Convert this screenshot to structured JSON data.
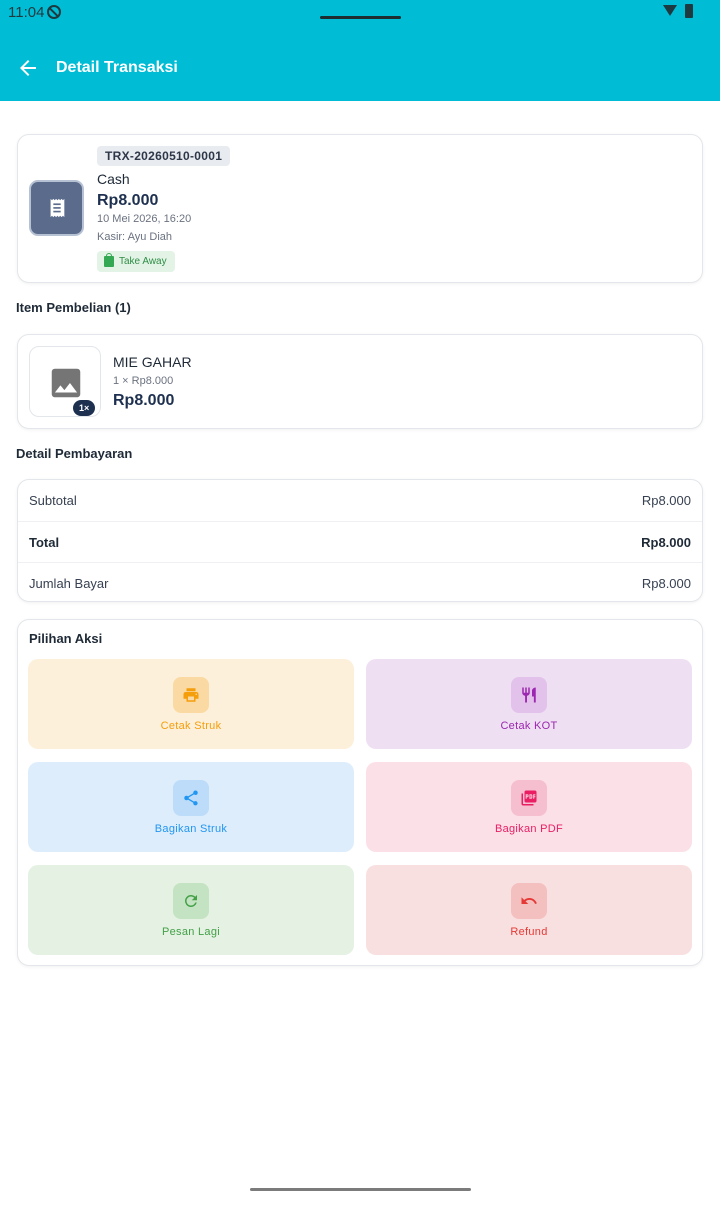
{
  "status_bar": {
    "time": "11:04"
  },
  "app_bar": {
    "title": "Detail Transaksi"
  },
  "transaction": {
    "id": "TRX-20260510-0001",
    "method": "Cash",
    "amount": "Rp8.000",
    "datetime": "10 Mei 2026, 16:20",
    "cashier": "Kasir: Ayu Diah",
    "order_type": "Take Away"
  },
  "items_section": {
    "title": "Item Pembelian (1)",
    "items": [
      {
        "name": "MIE GAHAR",
        "unit_line": "1 × Rp8.000",
        "total": "Rp8.000",
        "qty_badge": "1×"
      }
    ]
  },
  "payment_section": {
    "title": "Detail Pembayaran",
    "rows": [
      {
        "label": "Subtotal",
        "value": "Rp8.000"
      },
      {
        "label": "Total",
        "value": "Rp8.000"
      },
      {
        "label": "Jumlah Bayar",
        "value": "Rp8.000"
      }
    ]
  },
  "actions_section": {
    "title": "Pilihan Aksi",
    "actions": [
      {
        "label": "Cetak Struk",
        "icon": "printer-icon",
        "bg": "#fdf0da",
        "icon_bg": "#fbd9a3",
        "color": "#f59e0b"
      },
      {
        "label": "Cetak KOT",
        "icon": "utensils-icon",
        "bg": "#efdff3",
        "icon_bg": "#e2c1ea",
        "color": "#9c27b0"
      },
      {
        "label": "Bagikan Struk",
        "icon": "share-icon",
        "bg": "#deedfb",
        "icon_bg": "#bcdcfa",
        "color": "#2196f3"
      },
      {
        "label": "Bagikan PDF",
        "icon": "pdf-icon",
        "bg": "#fbe0e8",
        "icon_bg": "#f6bfd0",
        "color": "#e91e63"
      },
      {
        "label": "Pesan Lagi",
        "icon": "reorder-icon",
        "bg": "#e4f1e3",
        "icon_bg": "#c4e3c2",
        "color": "#43a047"
      },
      {
        "label": "Refund",
        "icon": "undo-icon",
        "bg": "#f9e0e0",
        "icon_bg": "#f4bfbf",
        "color": "#e53935"
      }
    ]
  },
  "theme": {
    "primary": "#00bcd4",
    "navy": "#1e3050"
  }
}
